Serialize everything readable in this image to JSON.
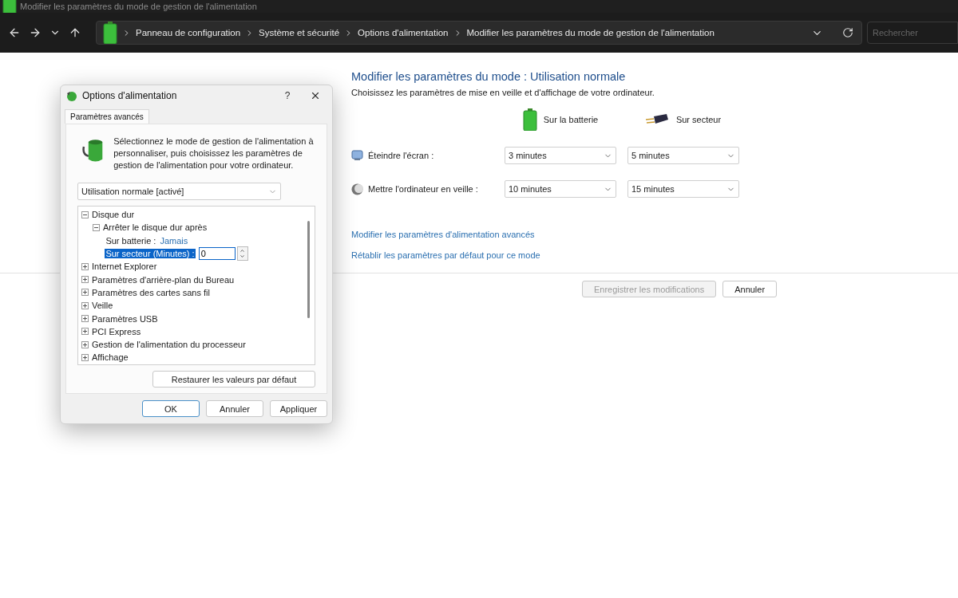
{
  "window": {
    "title": "Modifier les paramètres du mode de gestion de l'alimentation"
  },
  "nav": {
    "breadcrumb": [
      "Panneau de configuration",
      "Système et sécurité",
      "Options d'alimentation",
      "Modifier les paramètres du mode de gestion de l'alimentation"
    ],
    "search": {
      "placeholder": "Rechercher"
    }
  },
  "main": {
    "heading": "Modifier les paramètres du mode : Utilisation normale",
    "subtitle": "Choisissez les paramètres de mise en veille et d'affichage de votre ordinateur.",
    "columns": [
      {
        "kind": "battery",
        "label": "Sur la batterie"
      },
      {
        "kind": "plug",
        "label": "Sur secteur"
      }
    ],
    "settings": [
      {
        "kind": "display",
        "label": "Éteindre l'écran :",
        "values": [
          "3 minutes",
          "5 minutes"
        ]
      },
      {
        "kind": "sleep",
        "label": "Mettre l'ordinateur en veille :",
        "values": [
          "10 minutes",
          "15 minutes"
        ]
      }
    ],
    "links": [
      "Modifier les paramètres d'alimentation avancés",
      "Rétablir les paramètres par défaut pour ce mode"
    ],
    "buttons": [
      {
        "label": "Enregistrer les modifications",
        "disabled": true
      },
      {
        "label": "Annuler",
        "disabled": false
      }
    ]
  },
  "dialog": {
    "title": "Options d'alimentation",
    "help": "?",
    "tabs": [
      {
        "label": "Paramètres avancés",
        "selected": true
      }
    ],
    "description": "Sélectionnez le mode de gestion de l'alimentation à personnaliser, puis choisissez les paramètres de gestion de l'alimentation pour votre ordinateur.",
    "plan": "Utilisation normale [activé]",
    "tree": [
      {
        "kind": "group",
        "label": "Disque dur",
        "expanded": true,
        "children": [
          {
            "kind": "group",
            "label": "Arrêter le disque dur après",
            "expanded": true,
            "children": [
              {
                "kind": "value",
                "label": "Sur batterie :",
                "value": "Jamais",
                "selected": false
              },
              {
                "kind": "input",
                "label": "Sur secteur (Minutes) :",
                "value": "0",
                "selected": true
              }
            ]
          }
        ]
      },
      {
        "kind": "group",
        "label": "Internet Explorer",
        "expanded": false
      },
      {
        "kind": "group",
        "label": "Paramètres d'arrière-plan du Bureau",
        "expanded": false
      },
      {
        "kind": "group",
        "label": "Paramètres des cartes sans fil",
        "expanded": false
      },
      {
        "kind": "group",
        "label": "Veille",
        "expanded": false
      },
      {
        "kind": "group",
        "label": "Paramètres USB",
        "expanded": false
      },
      {
        "kind": "group",
        "label": "PCI Express",
        "expanded": false
      },
      {
        "kind": "group",
        "label": "Gestion de l'alimentation du processeur",
        "expanded": false
      },
      {
        "kind": "group",
        "label": "Affichage",
        "expanded": false
      }
    ],
    "restore": "Restaurer les valeurs par défaut",
    "buttons": [
      {
        "label": "OK",
        "default": true
      },
      {
        "label": "Annuler",
        "default": false
      },
      {
        "label": "Appliquer",
        "default": false
      }
    ]
  }
}
